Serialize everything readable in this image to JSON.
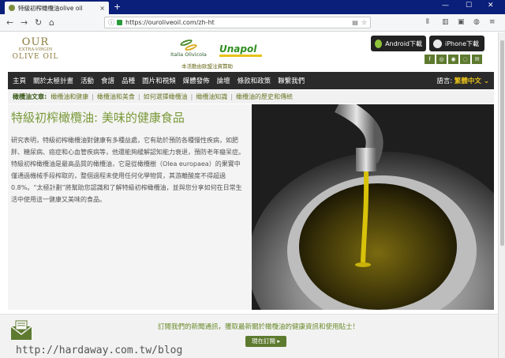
{
  "browser": {
    "tab_title": "特級初榨橄欖油olive oil",
    "tab_close": "×",
    "new_tab": "+",
    "url": "https://ouroliveoil.com/zh-ht",
    "window_controls": [
      "—",
      "☐",
      "✕"
    ]
  },
  "site": {
    "logo": {
      "line1": "OUR",
      "line2": "EXTRA-VIRGIN",
      "line3": "OLIVE OIL"
    },
    "partners": {
      "italia": "Italia Olivicola",
      "unapol": "Unapol",
      "caption": "本活動由歐盟注資贊助"
    },
    "apps": {
      "android": "Android下載",
      "iphone": "iPhone下載"
    },
    "social_icons": [
      "facebook-icon",
      "instagram-icon",
      "weibo-icon",
      "wechat-icon",
      "email-icon"
    ],
    "brand_color": "#5d7a2f",
    "accent_color": "#e8c21a"
  },
  "nav": {
    "items": [
      "主頁",
      "關於太極計畫",
      "活動",
      "食譜",
      "品種",
      "圖片和視頻",
      "媒體發佈",
      "論壇",
      "條款和政策",
      "聯繫我們"
    ],
    "lang_label": "語言:",
    "lang_value": "繁體中文 ⌄"
  },
  "subnav": {
    "heading": "橄欖油文章:",
    "links": [
      "橄欖油和健康",
      "橄欖油和美食",
      "如何選擇橄欖油",
      "橄欖油知識",
      "橄欖油的歷史和傳統"
    ]
  },
  "hero": {
    "title": "特級初榨橄欖油: 美味的健康食品",
    "body": "研究表明，特級初榨橄欖油對健康有多種益處，它有助於預防各種慢性疾病，如肥胖、糖尿病、癌症和心血管疾病等，他還能夠緩解認知能力衰退，預防老年癡呆症。特級初榨橄欖油是最高品質的橄欖油，它是從橄欖樹（Olea europaea）的果實中僅通過機械手段榨取的，整個過程未使用任何化學物質，其游離酸度不得超過0.8%。“太極計劃”將幫助您認識和了解特級初榨橄欖油，並與您分享如何在日常生活中使用這一健康又美味的食品。"
  },
  "newsletter": {
    "text": "訂閱我們的新聞通訊，獲取最新關於橄欖油的健康資訊和使用貼士！",
    "button": "現在訂閱 ▸"
  },
  "watermark": "http://hardaway.com.tw/blog"
}
